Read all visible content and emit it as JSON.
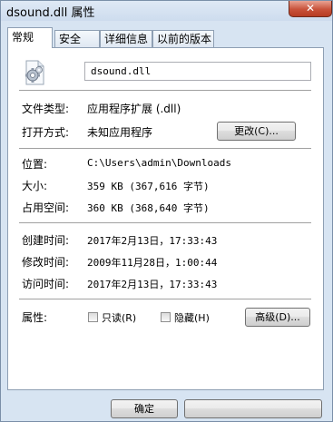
{
  "window": {
    "title": "dsound.dll 属性",
    "close_glyph": "✕"
  },
  "tabs": [
    {
      "label": "常规",
      "active": true
    },
    {
      "label": "安全",
      "active": false
    },
    {
      "label": "详细信息",
      "active": false
    },
    {
      "label": "以前的版本",
      "active": false
    }
  ],
  "general": {
    "icon": "dll-gear-icon",
    "filename": "dsound.dll",
    "file_type_label": "文件类型:",
    "file_type_value": "应用程序扩展 (.dll)",
    "opens_with_label": "打开方式:",
    "opens_with_value": "未知应用程序",
    "change_button": "更改(C)...",
    "location_label": "位置:",
    "location_value": "C:\\Users\\admin\\Downloads",
    "size_label": "大小:",
    "size_value": "359 KB (367,616 字节)",
    "size_on_disk_label": "占用空间:",
    "size_on_disk_value": "360 KB (368,640 字节)",
    "created_label": "创建时间:",
    "created_value": "2017年2月13日，17:33:43",
    "modified_label": "修改时间:",
    "modified_value": "2009年11月28日，1:00:44",
    "accessed_label": "访问时间:",
    "accessed_value": "2017年2月13日，17:33:43",
    "attributes_label": "属性:",
    "readonly_label": "只读(R)",
    "readonly_checked": false,
    "hidden_label": "隐藏(H)",
    "hidden_checked": false,
    "advanced_button": "高级(D)..."
  },
  "footer": {
    "ok_button": "确定"
  }
}
